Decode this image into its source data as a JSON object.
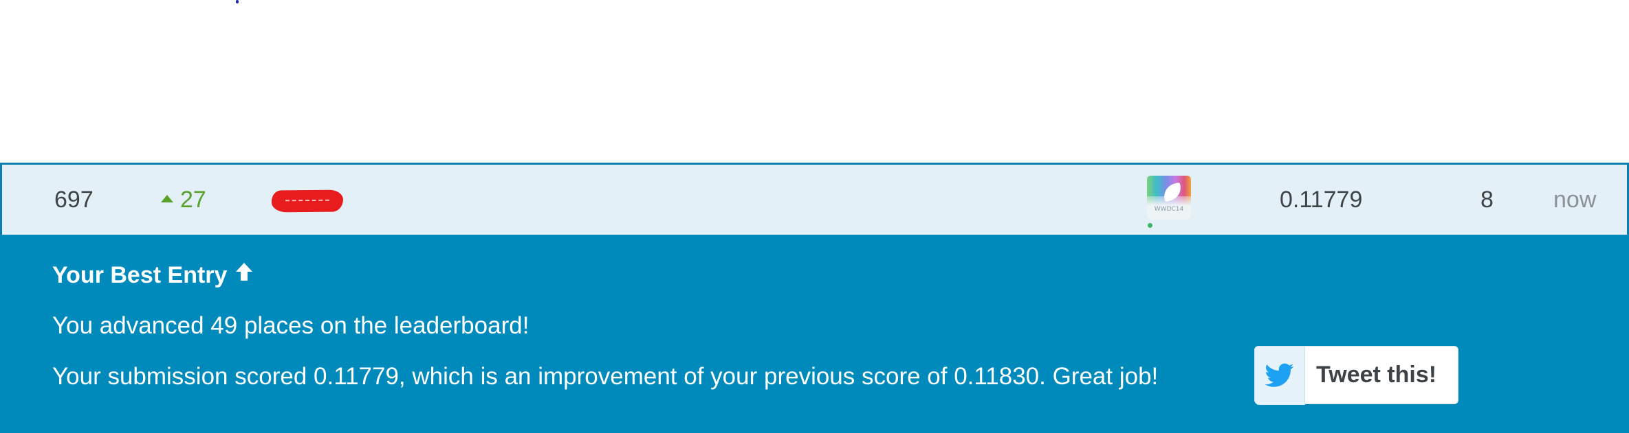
{
  "leaderboard_row": {
    "rank": "697",
    "change": "27",
    "team_avatar_text": "WWDC14",
    "score": "0.11779",
    "entries": "8",
    "last": "now"
  },
  "best_entry": {
    "title": "Your Best Entry",
    "advanced_text": "You advanced 49 places on the leaderboard!",
    "score_text": "Your submission scored 0.11779, which is an improvement of your previous score of 0.11830. Great job!",
    "tweet_label": "Tweet this!"
  },
  "colors": {
    "panel": "#008abb",
    "row_bg": "#e3f0f7",
    "row_border": "#0a7fb0",
    "positive_change": "#5aa02c",
    "twitter_blue": "#1da1f2"
  },
  "icons": {
    "change": "triangle-up-icon",
    "best_entry": "arrow-up-icon",
    "tweet": "twitter-bird-icon"
  }
}
